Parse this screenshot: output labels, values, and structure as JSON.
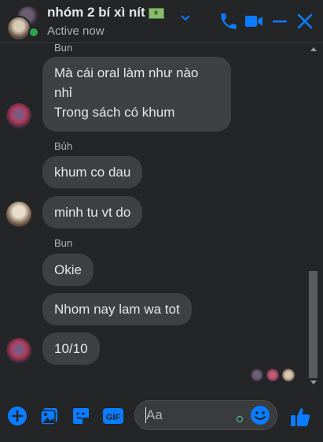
{
  "header": {
    "title": "nhóm 2 bí xì nít",
    "title_emoji": "money-banknote",
    "status": "Active now",
    "accent": "#0a7cff",
    "online_color": "#31a24c"
  },
  "messages": [
    {
      "type": "sender",
      "text": "Bun"
    },
    {
      "type": "bubble",
      "lines": [
        "Mà cái oral làm như nào",
        "nhỉ",
        "Trong sách có khum"
      ],
      "avatar": "bun"
    },
    {
      "type": "sender",
      "text": "Bủh"
    },
    {
      "type": "bubble",
      "lines": [
        "khum co dau"
      ]
    },
    {
      "type": "bubble",
      "lines": [
        "minh tu vt do"
      ],
      "avatar": "buh"
    },
    {
      "type": "sender",
      "text": "Bun"
    },
    {
      "type": "bubble",
      "lines": [
        "Okie"
      ]
    },
    {
      "type": "bubble",
      "lines": [
        "Nhom nay lam wa tot"
      ]
    },
    {
      "type": "bubble",
      "lines": [
        "10/10"
      ],
      "avatar": "bun"
    }
  ],
  "seen_by_count": 3,
  "composer": {
    "placeholder": "Aa",
    "value": "",
    "icons": [
      "plus-icon",
      "image-icon",
      "sticker-icon",
      "gif-icon",
      "emoji-icon",
      "like-icon"
    ]
  },
  "colors": {
    "background": "#242526",
    "bubble": "#3e4042",
    "text": "#e4e6eb",
    "muted": "#b0b3b8"
  }
}
